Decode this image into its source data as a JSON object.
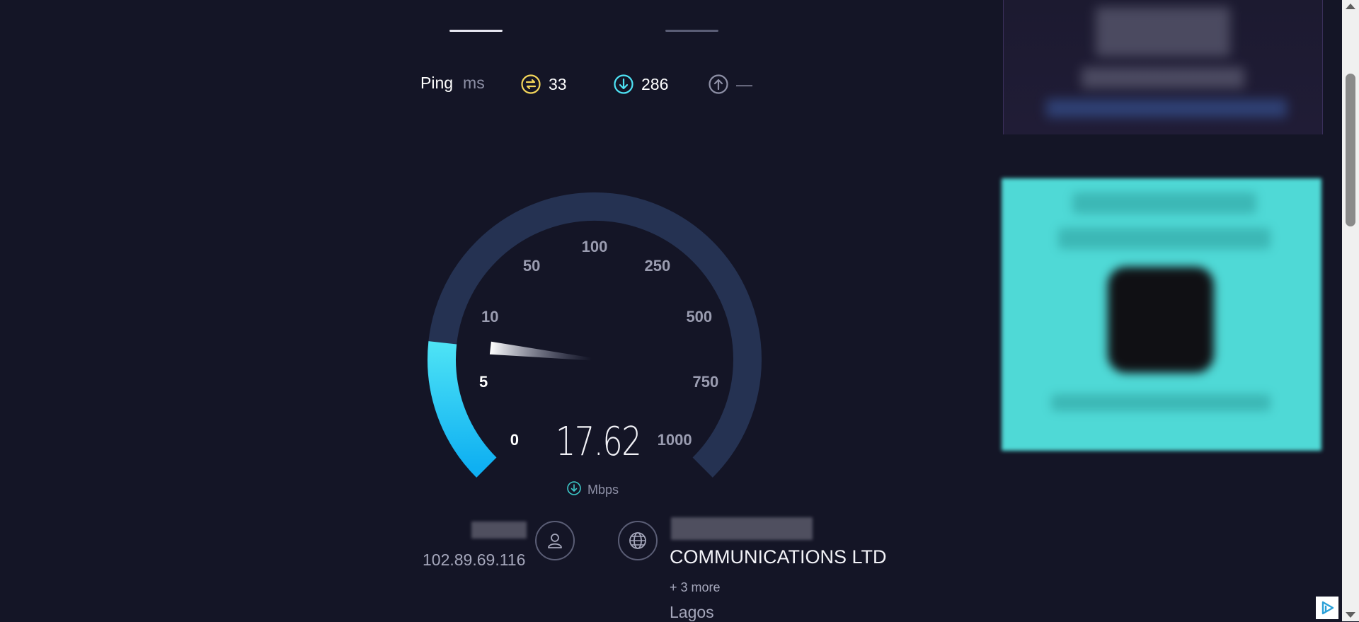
{
  "stats": {
    "ping_label": "Ping",
    "ping_unit": "ms",
    "jitter_value": "33",
    "download_value": "286",
    "upload_value": "—"
  },
  "gauge": {
    "scale_labels": [
      "0",
      "5",
      "10",
      "50",
      "100",
      "250",
      "500",
      "750",
      "1000"
    ],
    "current_speed": "17.62",
    "unit": "Mbps",
    "fill_fraction": 0.19,
    "colors": {
      "fill_start": "#1ab8f0",
      "fill_end": "#4ee3f5",
      "track": "#253252",
      "needle": "#ffffff"
    }
  },
  "client": {
    "ip": "102.89.69.116",
    "isp": "COMMUNICATIONS LTD",
    "more_servers": "+ 3 more",
    "location": "Lagos"
  },
  "colors": {
    "background": "#141526",
    "accent": "#4ee3f5",
    "jitter_icon": "#f5d75a",
    "download_icon": "#4ee3f5",
    "muted_text": "#8e90a6"
  },
  "icons": {
    "jitter": "jitter-icon",
    "download": "download-arrow-icon",
    "upload": "upload-arrow-icon",
    "user": "user-icon",
    "globe": "globe-icon",
    "adchoices": "adchoices-icon"
  }
}
